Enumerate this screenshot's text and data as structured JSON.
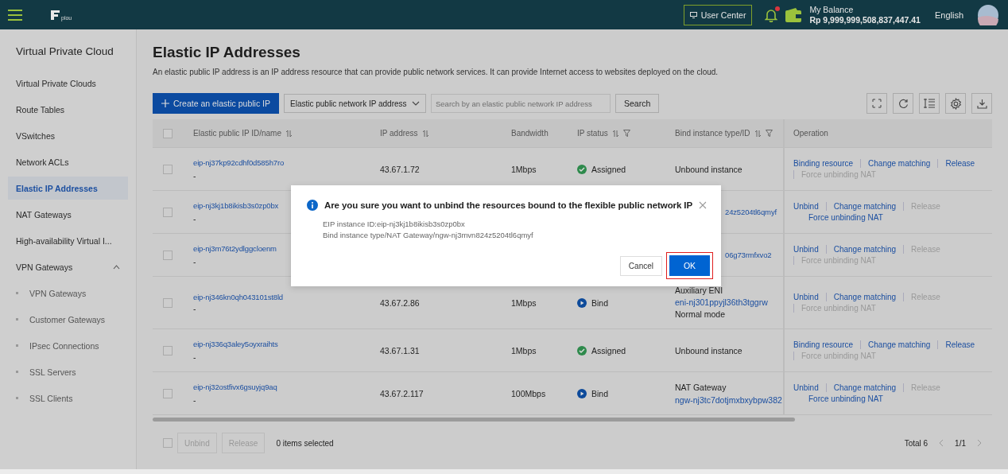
{
  "header": {
    "logo_text": "plou",
    "user_center": "User Center",
    "notification": {
      "unread": true
    },
    "balance_label": "My Balance",
    "balance": "Rp 9,999,999,508,837,447.41",
    "language": "English"
  },
  "sidebar": {
    "title": "Virtual Private Cloud",
    "items": [
      {
        "label": "Virtual Private Clouds",
        "selected": false
      },
      {
        "label": "Route Tables",
        "selected": false
      },
      {
        "label": "VSwitches",
        "selected": false
      },
      {
        "label": "Network ACLs",
        "selected": false
      },
      {
        "label": "Elastic IP Addresses",
        "selected": true
      },
      {
        "label": "NAT Gateways",
        "selected": false
      },
      {
        "label": "High-availability Virtual I...",
        "selected": false
      },
      {
        "label": "VPN Gateways",
        "selected": false,
        "expanded": true,
        "children": [
          {
            "label": "VPN Gateways",
            "selected": false
          },
          {
            "label": "Customer Gateways",
            "selected": false
          },
          {
            "label": "IPsec Connections",
            "selected": false
          },
          {
            "label": "SSL Servers",
            "selected": false
          },
          {
            "label": "SSL Clients",
            "selected": false
          }
        ]
      }
    ]
  },
  "page": {
    "title": "Elastic IP Addresses",
    "description": "An elastic public IP address is an IP address resource that can provide public network services. It can provide Internet access to websites deployed on the cloud.",
    "create_button": "Create an elastic public IP",
    "filter_select": "Elastic public network IP address",
    "search": {
      "placeholder": "Search by an elastic public network IP address"
    },
    "search_button": "Search"
  },
  "table": {
    "header_checkbox": {
      "checked": false
    },
    "columns": [
      {
        "label": "Elastic public IP ID/name",
        "sortable": true,
        "filterable": false
      },
      {
        "label": "IP address",
        "sortable": true,
        "filterable": false
      },
      {
        "label": "Bandwidth",
        "sortable": false,
        "filterable": false
      },
      {
        "label": "IP status",
        "sortable": true,
        "filterable": true
      },
      {
        "label": "Bind instance type/ID",
        "sortable": true,
        "filterable": true
      },
      {
        "label": "Operation",
        "sortable": false,
        "filterable": false
      }
    ],
    "rows": [
      {
        "checked": false,
        "name": "eip-nj37kp92cdhf0d585h7ro",
        "sub": "-",
        "ip": "43.67.1.72",
        "bandwidth": "1Mbps",
        "status": {
          "kind": "assigned",
          "label": "Assigned"
        },
        "bind": [
          {
            "kind": "text",
            "text": "Unbound instance"
          }
        ],
        "operations": [
          {
            "label": "Binding resource",
            "disabled": false
          },
          {
            "label": "Change matching",
            "disabled": false
          },
          {
            "label": "Release",
            "disabled": false
          },
          {
            "label": "Force unbinding NAT",
            "disabled": true
          }
        ]
      },
      {
        "checked": false,
        "name": "eip-nj3kj1b8ikisb3s0zp0bx",
        "sub": "-",
        "bind": [
          {
            "kind": "link-cut",
            "text": "24z5204tl6qmyf"
          }
        ],
        "operations": [
          {
            "label": "Unbind",
            "disabled": false
          },
          {
            "label": "Change matching",
            "disabled": false
          },
          {
            "label": "Release",
            "disabled": true
          },
          {
            "label": "Force unbinding NAT",
            "disabled": false
          }
        ]
      },
      {
        "checked": false,
        "name": "eip-nj3m76t2ydlggcloenm",
        "sub": "-",
        "bind": [
          {
            "kind": "link-cut",
            "text": "06g73rmfxvo2"
          }
        ],
        "operations": [
          {
            "label": "Unbind",
            "disabled": false
          },
          {
            "label": "Change matching",
            "disabled": false
          },
          {
            "label": "Release",
            "disabled": true
          },
          {
            "label": "Force unbinding NAT",
            "disabled": true
          }
        ]
      },
      {
        "checked": false,
        "name": "eip-nj346kn0qh043101st8ld",
        "sub": "-",
        "ip": "43.67.2.86",
        "bandwidth": "1Mbps",
        "status": {
          "kind": "bind",
          "label": "Bind"
        },
        "bind": [
          {
            "kind": "text",
            "text": "Auxiliary ENI"
          },
          {
            "kind": "link",
            "text": "eni-nj301ppyjl36th3tggrw"
          },
          {
            "kind": "text",
            "text": "Normal mode"
          }
        ],
        "operations": [
          {
            "label": "Unbind",
            "disabled": false
          },
          {
            "label": "Change matching",
            "disabled": false
          },
          {
            "label": "Release",
            "disabled": true
          },
          {
            "label": "Force unbinding NAT",
            "disabled": true
          }
        ]
      },
      {
        "checked": false,
        "name": "eip-nj336q3aley5oyxraihts",
        "sub": "-",
        "ip": "43.67.1.31",
        "bandwidth": "1Mbps",
        "status": {
          "kind": "assigned",
          "label": "Assigned"
        },
        "bind": [
          {
            "kind": "text",
            "text": "Unbound instance"
          }
        ],
        "operations": [
          {
            "label": "Binding resource",
            "disabled": false
          },
          {
            "label": "Change matching",
            "disabled": false
          },
          {
            "label": "Release",
            "disabled": false
          },
          {
            "label": "Force unbinding NAT",
            "disabled": true
          }
        ]
      },
      {
        "checked": false,
        "name": "eip-nj32ostfivx6gsuyjq9aq",
        "sub": "-",
        "ip": "43.67.2.117",
        "bandwidth": "100Mbps",
        "status": {
          "kind": "bind",
          "label": "Bind"
        },
        "bind": [
          {
            "kind": "text",
            "text": "NAT Gateway"
          },
          {
            "kind": "link",
            "text": "ngw-nj3tc7dotjmxbxybpw382"
          }
        ],
        "operations": [
          {
            "label": "Unbind",
            "disabled": false
          },
          {
            "label": "Change matching",
            "disabled": false
          },
          {
            "label": "Release",
            "disabled": true
          },
          {
            "label": "Force unbinding NAT",
            "disabled": false
          }
        ]
      }
    ]
  },
  "footer": {
    "select_all": {
      "checked": false
    },
    "buttons": [
      {
        "label": "Unbind",
        "disabled": true
      },
      {
        "label": "Release",
        "disabled": true
      }
    ],
    "selected_text": "0 items selected",
    "total": "Total 6",
    "page": "1/1"
  },
  "dialog": {
    "title": "Are you sure you want to unbind the resources bound to the flexible public network IP",
    "lines": [
      "EIP instance ID:eip-nj3kj1b8ikisb3s0zp0bx",
      "Bind instance type/NAT Gateway/ngw-nj3mvn824z5204tl6qmyf"
    ],
    "cancel": "Cancel",
    "ok": "OK",
    "ok_highlighted": true
  }
}
